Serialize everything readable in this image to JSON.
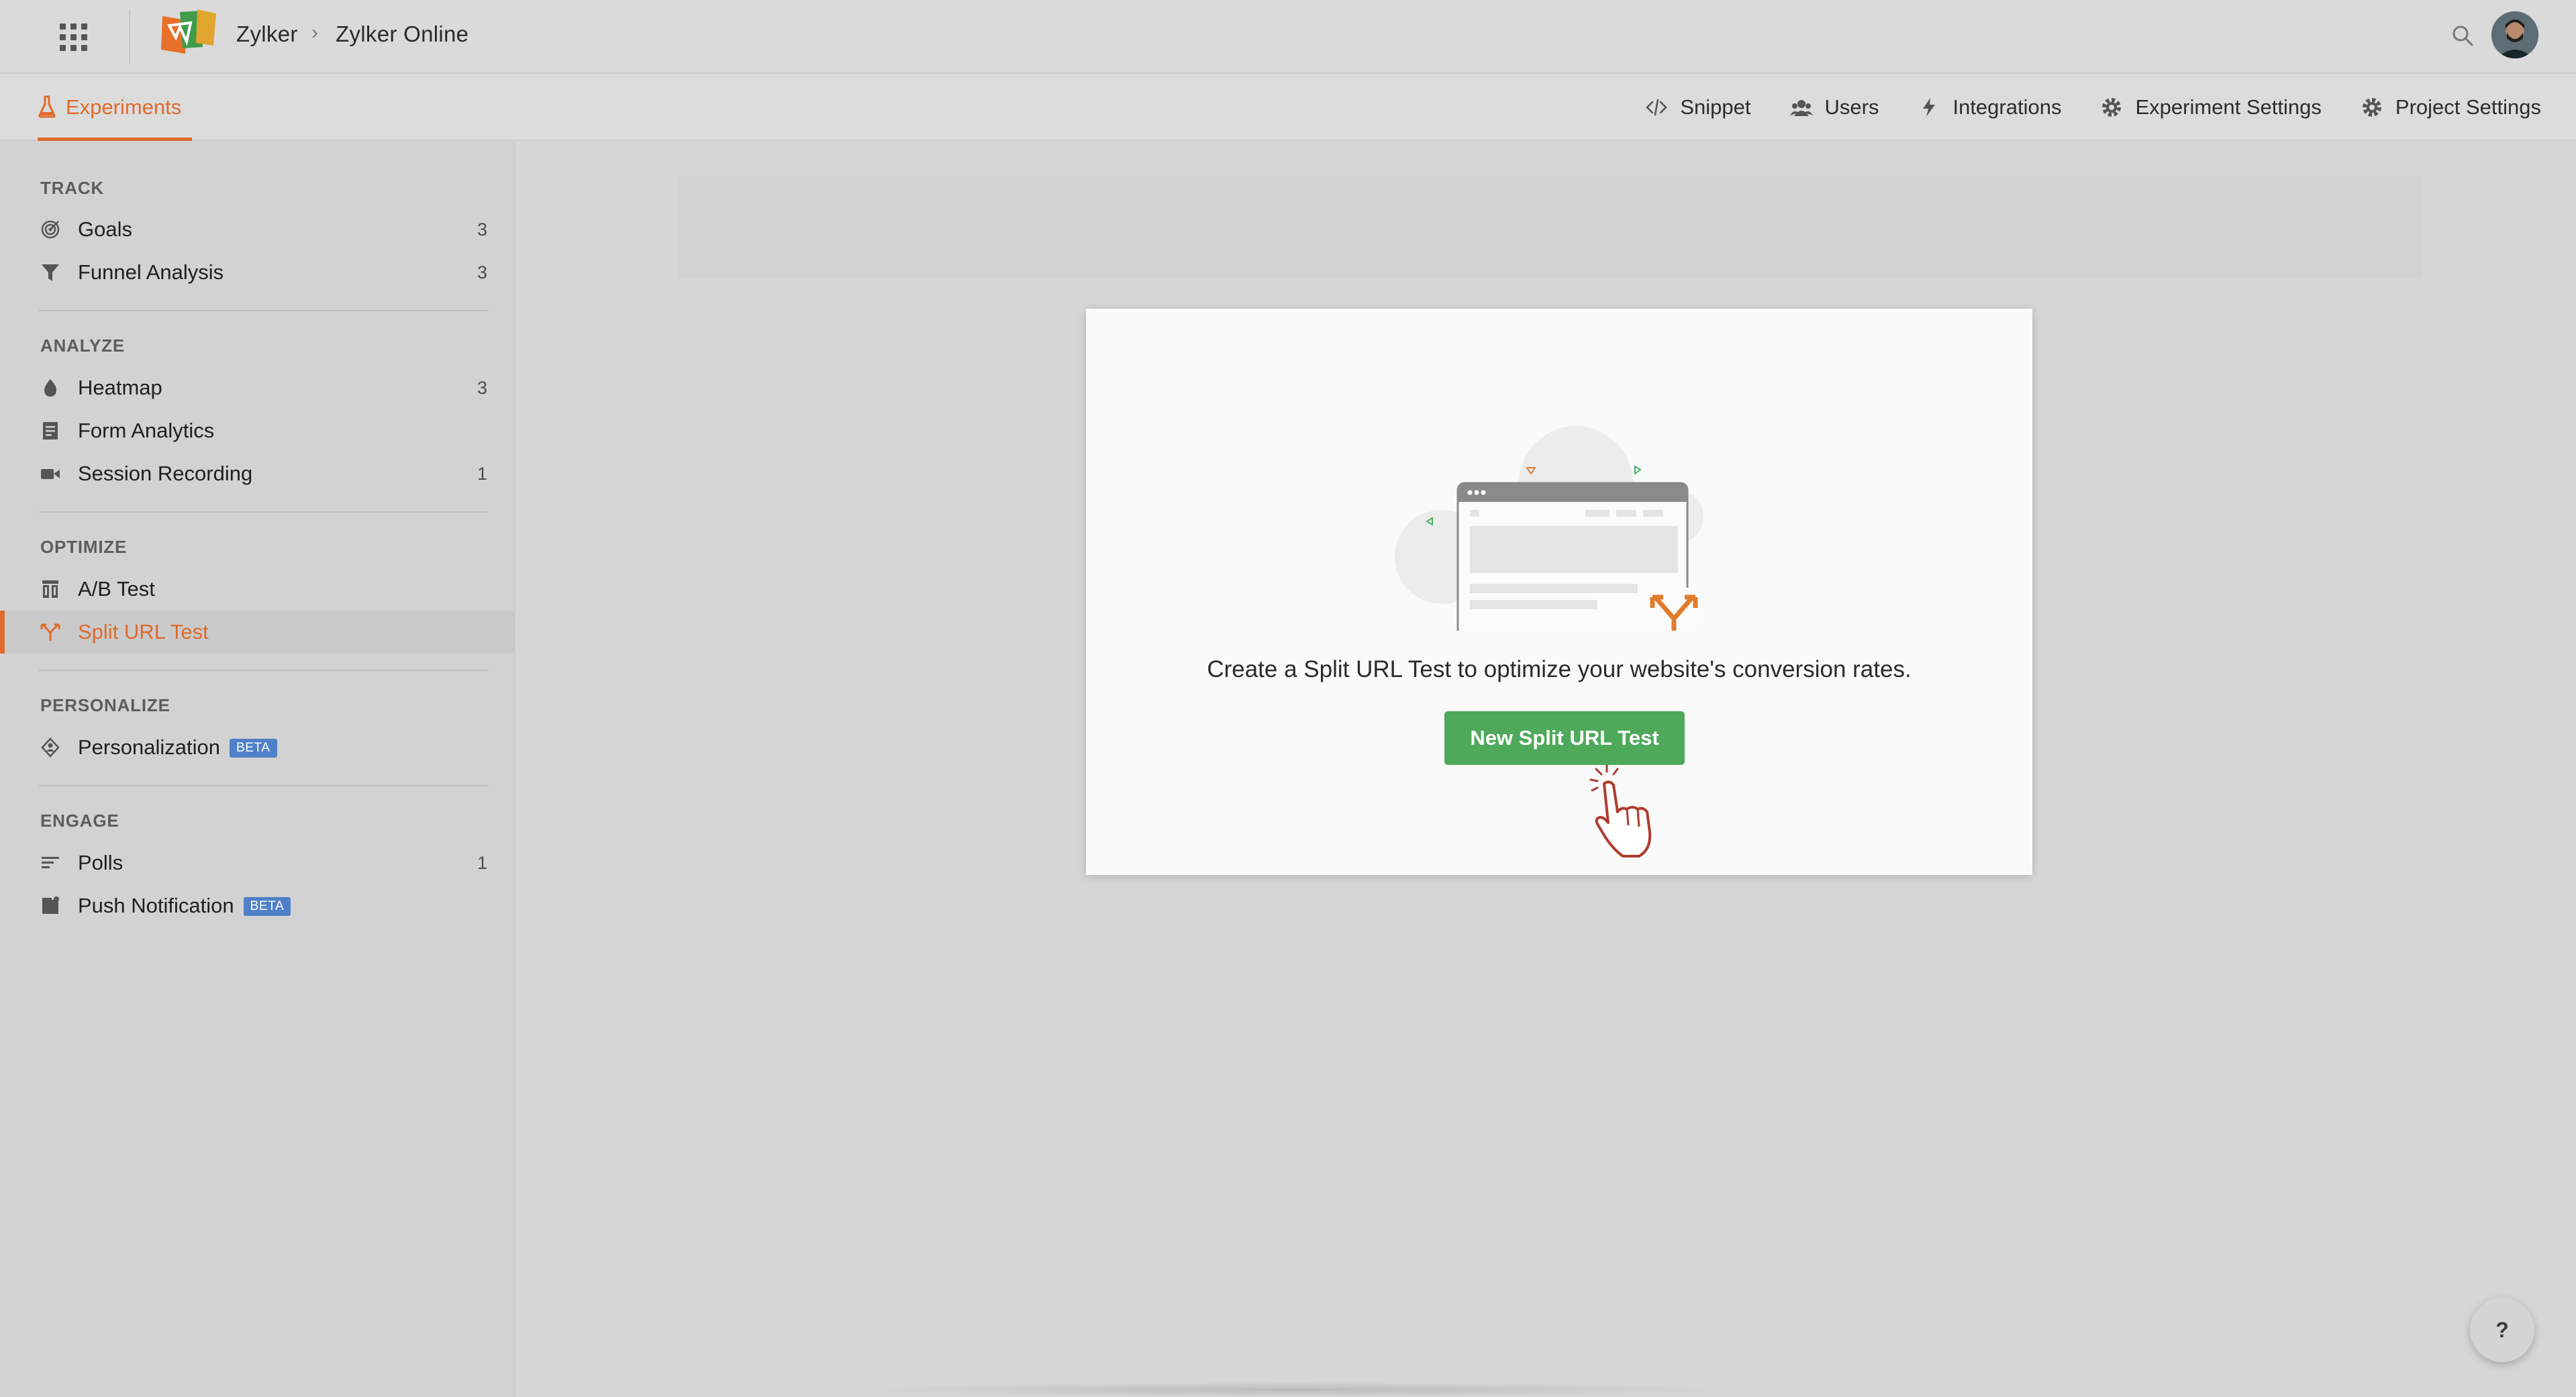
{
  "header": {
    "org": "Zylker",
    "separator": "›",
    "project": "Zylker Online"
  },
  "tabs": {
    "active": "Experiments",
    "links": [
      "Snippet",
      "Users",
      "Integrations",
      "Experiment Settings",
      "Project Settings"
    ]
  },
  "sidebar": {
    "sections": [
      {
        "title": "TRACK",
        "items": [
          {
            "label": "Goals",
            "count": "3",
            "icon": "target-icon"
          },
          {
            "label": "Funnel Analysis",
            "count": "3",
            "icon": "funnel-icon"
          }
        ]
      },
      {
        "title": "ANALYZE",
        "items": [
          {
            "label": "Heatmap",
            "count": "3",
            "icon": "flame-icon"
          },
          {
            "label": "Form Analytics",
            "count": "",
            "icon": "form-icon"
          },
          {
            "label": "Session Recording",
            "count": "1",
            "icon": "video-icon"
          }
        ]
      },
      {
        "title": "OPTIMIZE",
        "items": [
          {
            "label": "A/B Test",
            "count": "",
            "icon": "ab-test-icon"
          },
          {
            "label": "Split URL Test",
            "count": "",
            "icon": "split-icon",
            "active": true
          }
        ]
      },
      {
        "title": "PERSONALIZE",
        "items": [
          {
            "label": "Personalization",
            "count": "",
            "icon": "personalize-icon",
            "badge": "BETA"
          }
        ]
      },
      {
        "title": "ENGAGE",
        "items": [
          {
            "label": "Polls",
            "count": "1",
            "icon": "polls-icon"
          },
          {
            "label": "Push Notification",
            "count": "",
            "icon": "bell-icon",
            "badge": "BETA"
          }
        ]
      }
    ]
  },
  "main": {
    "message": "Create a Split URL Test to optimize your website's conversion rates.",
    "button_label": "New Split URL Test"
  },
  "help": {
    "label": "?"
  },
  "colors": {
    "accent": "#e06a2c",
    "primary_button": "#4fa95a",
    "beta_badge": "#4f80c8"
  }
}
